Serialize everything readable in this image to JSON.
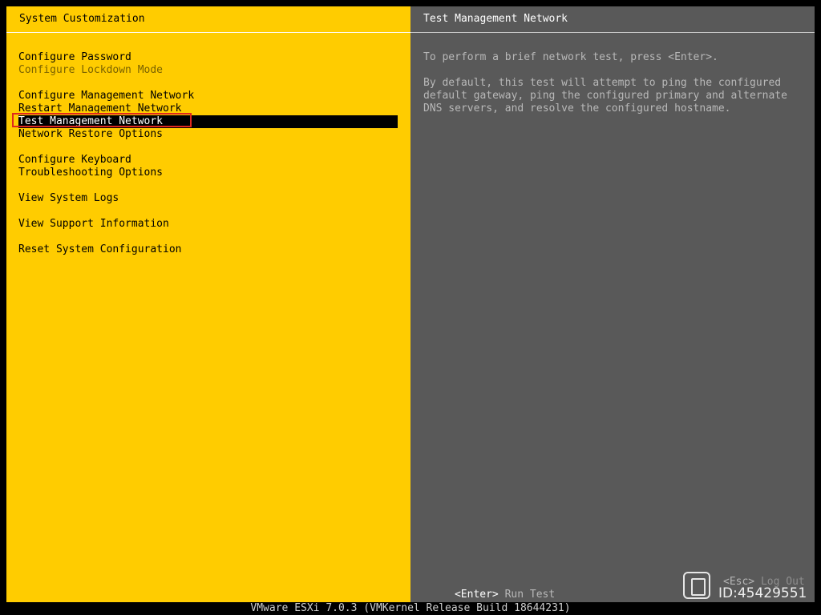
{
  "left_panel": {
    "title": "System Customization",
    "menu": [
      {
        "label": "Configure Password",
        "enabled": true,
        "selected": false
      },
      {
        "label": "Configure Lockdown Mode",
        "enabled": false,
        "selected": false
      },
      {
        "label": "Configure Management Network",
        "enabled": true,
        "selected": false
      },
      {
        "label": "Restart Management Network",
        "enabled": true,
        "selected": false
      },
      {
        "label": "Test Management Network",
        "enabled": true,
        "selected": true
      },
      {
        "label": "Network Restore Options",
        "enabled": true,
        "selected": false
      },
      {
        "label": "Configure Keyboard",
        "enabled": true,
        "selected": false
      },
      {
        "label": "Troubleshooting Options",
        "enabled": true,
        "selected": false
      },
      {
        "label": "View System Logs",
        "enabled": true,
        "selected": false
      },
      {
        "label": "View Support Information",
        "enabled": true,
        "selected": false
      },
      {
        "label": "Reset System Configuration",
        "enabled": true,
        "selected": false
      }
    ]
  },
  "right_panel": {
    "title": "Test Management Network",
    "description_1": "To perform a brief network test, press <Enter>.",
    "description_2_lines": [
      "By default, this test will attempt to ping the configured",
      "default gateway, ping the configured primary and alternate",
      "DNS servers, and resolve the configured hostname."
    ],
    "footer_key": "<Enter>",
    "footer_action": "Run Test",
    "footer_key_2": "<Esc>",
    "footer_action_2": "Log Out"
  },
  "status_bar": "VMware ESXi 7.0.3 (VMKernel Release Build 18644231)",
  "watermark": {
    "id_text": "ID:45429551"
  },
  "colors": {
    "left_bg": "#ffcc00",
    "right_bg": "#595959",
    "selection_bg": "#000000",
    "annotation_box": "#e0281e"
  }
}
